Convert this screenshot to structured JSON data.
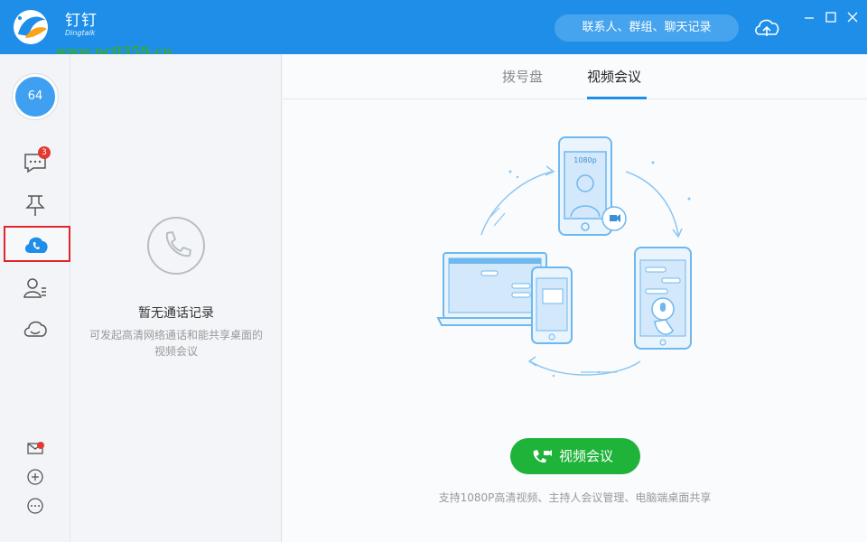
{
  "app": {
    "name_cn": "钉钉",
    "name_en": "Dingtalk",
    "watermark": "www.pc0359.cn"
  },
  "header": {
    "search_placeholder": "联系人、群组、聊天记录",
    "window_controls": [
      "minimize-icon",
      "maximize-icon",
      "close-icon"
    ]
  },
  "sidebar": {
    "avatar_text": "64",
    "message_badge": "3",
    "items": [
      "message-icon",
      "pin-icon",
      "phone-icon",
      "contacts-icon",
      "cloud-icon"
    ],
    "bottom_items": [
      "mail-icon",
      "add-icon",
      "more-icon"
    ],
    "active": "phone-icon"
  },
  "records": {
    "empty_title": "暂无通话记录",
    "empty_sub": "可发起高清网络通话和能共享桌面的视频会议"
  },
  "main": {
    "tabs": [
      {
        "label": "拨号盘",
        "active": false
      },
      {
        "label": "视频会议",
        "active": true
      }
    ],
    "illustration_label": "1080p",
    "video_button": "视频会议",
    "support_text": "支持1080P高清视频、主持人会议管理、电脑端桌面共享"
  },
  "colors": {
    "brand": "#1e8ee8",
    "accent_green": "#1fb33a",
    "badge_red": "#e23a31"
  }
}
